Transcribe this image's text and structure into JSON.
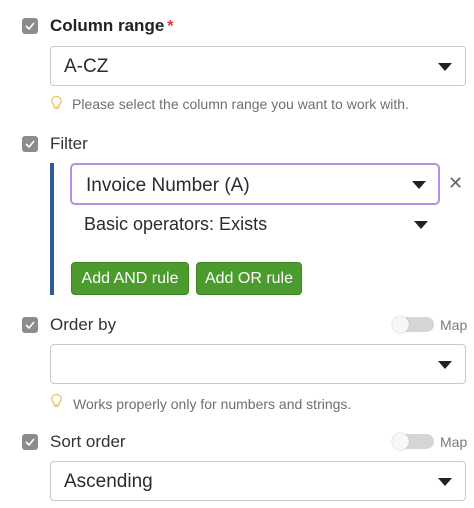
{
  "column_range": {
    "label": "Column range",
    "required_mark": "*",
    "value": "A-CZ",
    "hint": "Please select the column range you want to work with."
  },
  "filter": {
    "label": "Filter",
    "field_value": "Invoice Number (A)",
    "operator_value": "Basic operators: Exists",
    "remove_symbol": "✕",
    "add_and_label": "Add AND rule",
    "add_or_label": "Add OR rule"
  },
  "order_by": {
    "label": "Order by",
    "value": "",
    "map_label": "Map",
    "hint": "Works properly only for numbers and strings."
  },
  "sort_order": {
    "label": "Sort order",
    "value": "Ascending",
    "map_label": "Map"
  },
  "colors": {
    "accent_blue": "#2e5c9a",
    "focus_purple": "#b190e6",
    "button_green": "#4c9b2f",
    "required_red": "#e0333a"
  },
  "icons": [
    "checkbox-check-icon",
    "lightbulb-icon",
    "caret-down-icon",
    "close-icon"
  ]
}
